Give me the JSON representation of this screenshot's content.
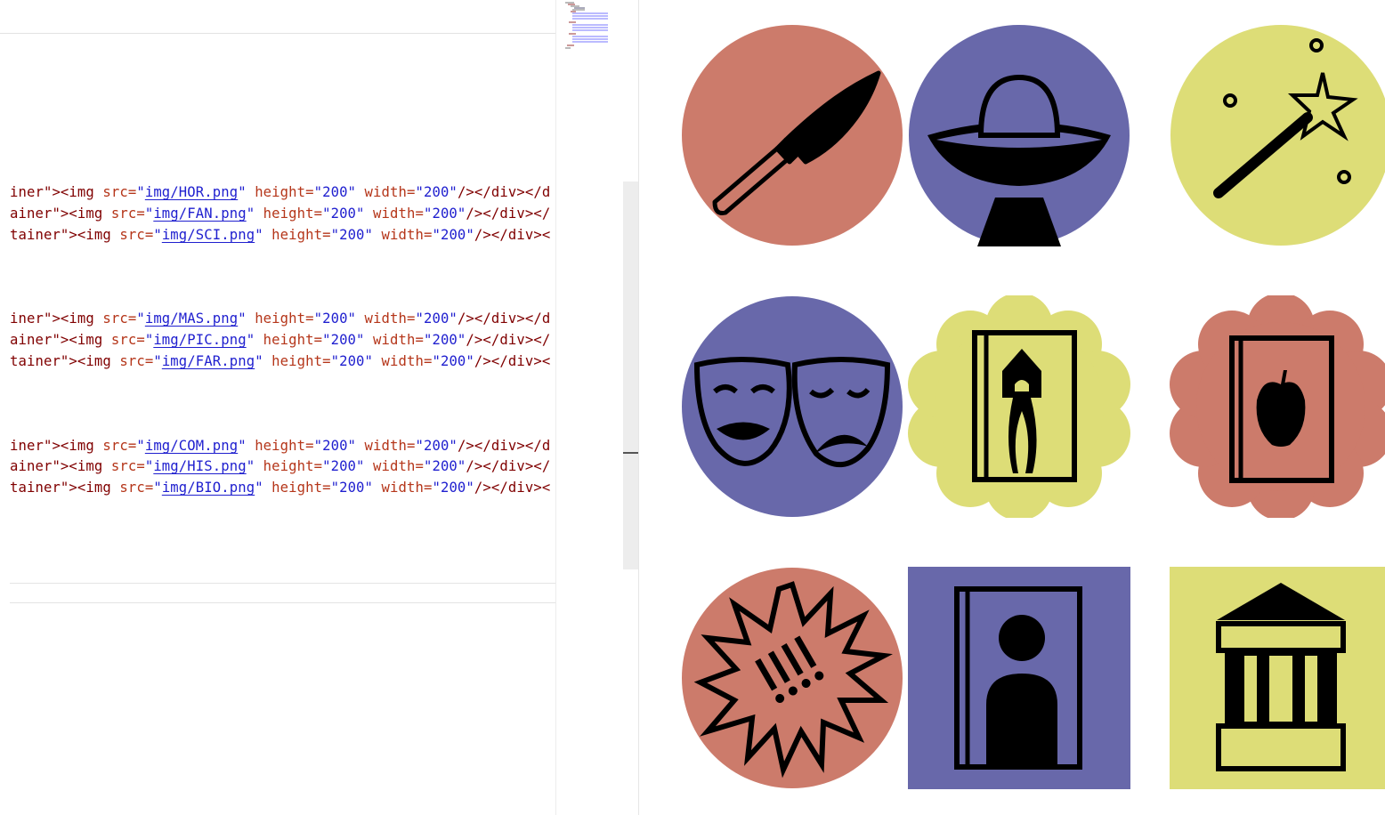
{
  "editor": {
    "lines": [
      {
        "prefix": "iner\"><img ",
        "src_attr": "src=",
        "q1": "\"",
        "file": "img/HOR.png",
        "q2": "\"",
        "h_attr": " height=",
        "h_val": "\"200\"",
        "w_attr": " width=",
        "w_val": "\"200\"",
        "tail": "/></div></d"
      },
      {
        "prefix": "ainer\"><img ",
        "src_attr": "src=",
        "q1": "\"",
        "file": "img/FAN.png",
        "q2": "\"",
        "h_attr": " height=",
        "h_val": "\"200\"",
        "w_attr": " width=",
        "w_val": "\"200\"",
        "tail": "/></div></"
      },
      {
        "prefix": "tainer\"><img ",
        "src_attr": "src=",
        "q1": "\"",
        "file": "img/SCI.png",
        "q2": "\"",
        "h_attr": " height=",
        "h_val": "\"200\"",
        "w_attr": " width=",
        "w_val": "\"200\"",
        "tail": "/></div><"
      },
      {
        "prefix": "iner\"><img ",
        "src_attr": "src=",
        "q1": "\"",
        "file": "img/MAS.png",
        "q2": "\"",
        "h_attr": " height=",
        "h_val": "\"200\"",
        "w_attr": " width=",
        "w_val": "\"200\"",
        "tail": "/></div></d"
      },
      {
        "prefix": "ainer\"><img ",
        "src_attr": "src=",
        "q1": "\"",
        "file": "img/PIC.png",
        "q2": "\"",
        "h_attr": " height=",
        "h_val": "\"200\"",
        "w_attr": " width=",
        "w_val": "\"200\"",
        "tail": "/></div></"
      },
      {
        "prefix": "tainer\"><img ",
        "src_attr": "src=",
        "q1": "\"",
        "file": "img/FAR.png",
        "q2": "\"",
        "h_attr": " height=",
        "h_val": "\"200\"",
        "w_attr": " width=",
        "w_val": "\"200\"",
        "tail": "/></div><"
      },
      {
        "prefix": "iner\"><img ",
        "src_attr": "src=",
        "q1": "\"",
        "file": "img/COM.png",
        "q2": "\"",
        "h_attr": " height=",
        "h_val": "\"200\"",
        "w_attr": " width=",
        "w_val": "\"200\"",
        "tail": "/></div></d"
      },
      {
        "prefix": "ainer\"><img ",
        "src_attr": "src=",
        "q1": "\"",
        "file": "img/HIS.png",
        "q2": "\"",
        "h_attr": " height=",
        "h_val": "\"200\"",
        "w_attr": " width=",
        "w_val": "\"200\"",
        "tail": "/></div></"
      },
      {
        "prefix": "tainer\"><img ",
        "src_attr": "src=",
        "q1": "\"",
        "file": "img/BIO.png",
        "q2": "\"",
        "h_attr": " height=",
        "h_val": "\"200\"",
        "w_attr": " width=",
        "w_val": "\"200\"",
        "tail": "/></div><"
      }
    ]
  },
  "colors": {
    "red": "#cc7b6b",
    "blue": "#6868aa",
    "yellow": "#dddd77",
    "ink": "#000000"
  },
  "preview": {
    "icons": [
      {
        "name": "horror-knife-icon"
      },
      {
        "name": "scifi-ufo-icon"
      },
      {
        "name": "fantasy-magic-wand-icon"
      },
      {
        "name": "drama-masks-icon"
      },
      {
        "name": "fairytale-tower-book-icon"
      },
      {
        "name": "school-apple-book-icon"
      },
      {
        "name": "comedy-burst-icon"
      },
      {
        "name": "biography-portrait-book-icon"
      },
      {
        "name": "history-building-icon"
      }
    ]
  }
}
